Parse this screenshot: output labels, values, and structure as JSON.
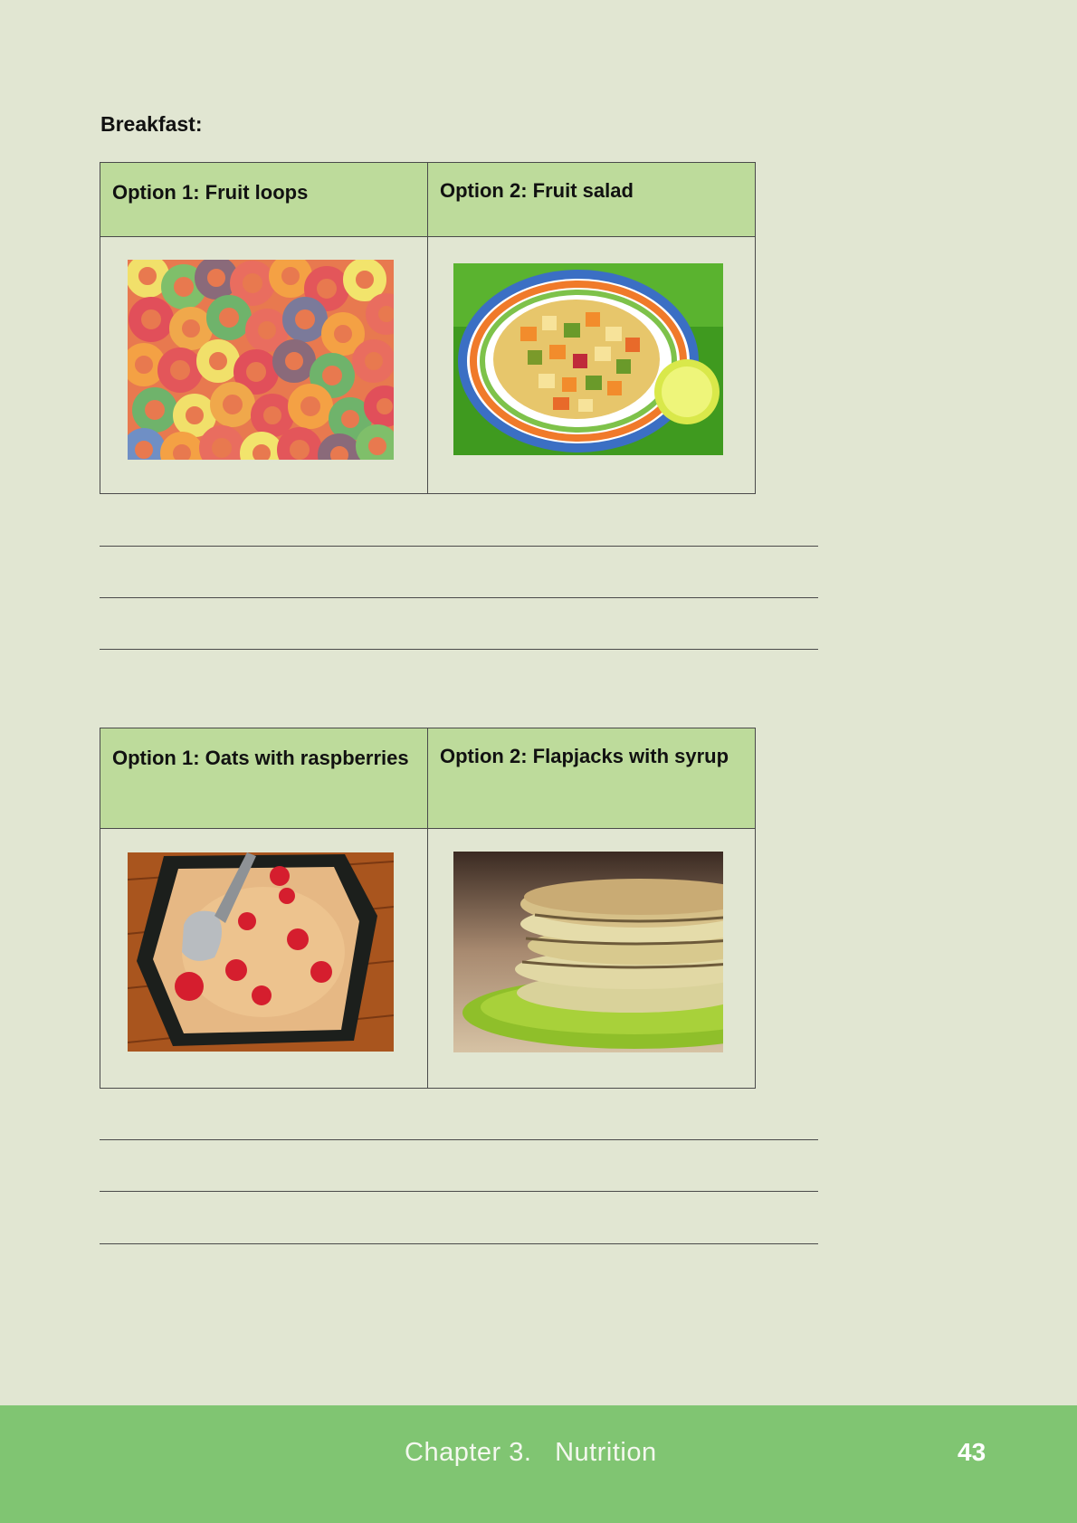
{
  "section": {
    "heading": "Breakfast:"
  },
  "comparisons": [
    {
      "option1": {
        "label": "Option 1: Fruit loops",
        "image": "fruit-loops-photo"
      },
      "option2": {
        "label": "Option 2: Fruit salad",
        "image": "fruit-salad-photo"
      }
    },
    {
      "option1": {
        "label": "Option 1: Oats with raspberries",
        "image": "oats-raspberries-photo"
      },
      "option2": {
        "label": "Option 2: Flapjacks with syrup",
        "image": "flapjacks-syrup-photo"
      }
    }
  ],
  "footer": {
    "chapter": "Chapter 3.   Nutrition",
    "page_number": "43"
  },
  "colors": {
    "page_bg": "#e1e6d2",
    "header_cell_bg": "#bddb9b",
    "footer_bg": "#80c572"
  }
}
